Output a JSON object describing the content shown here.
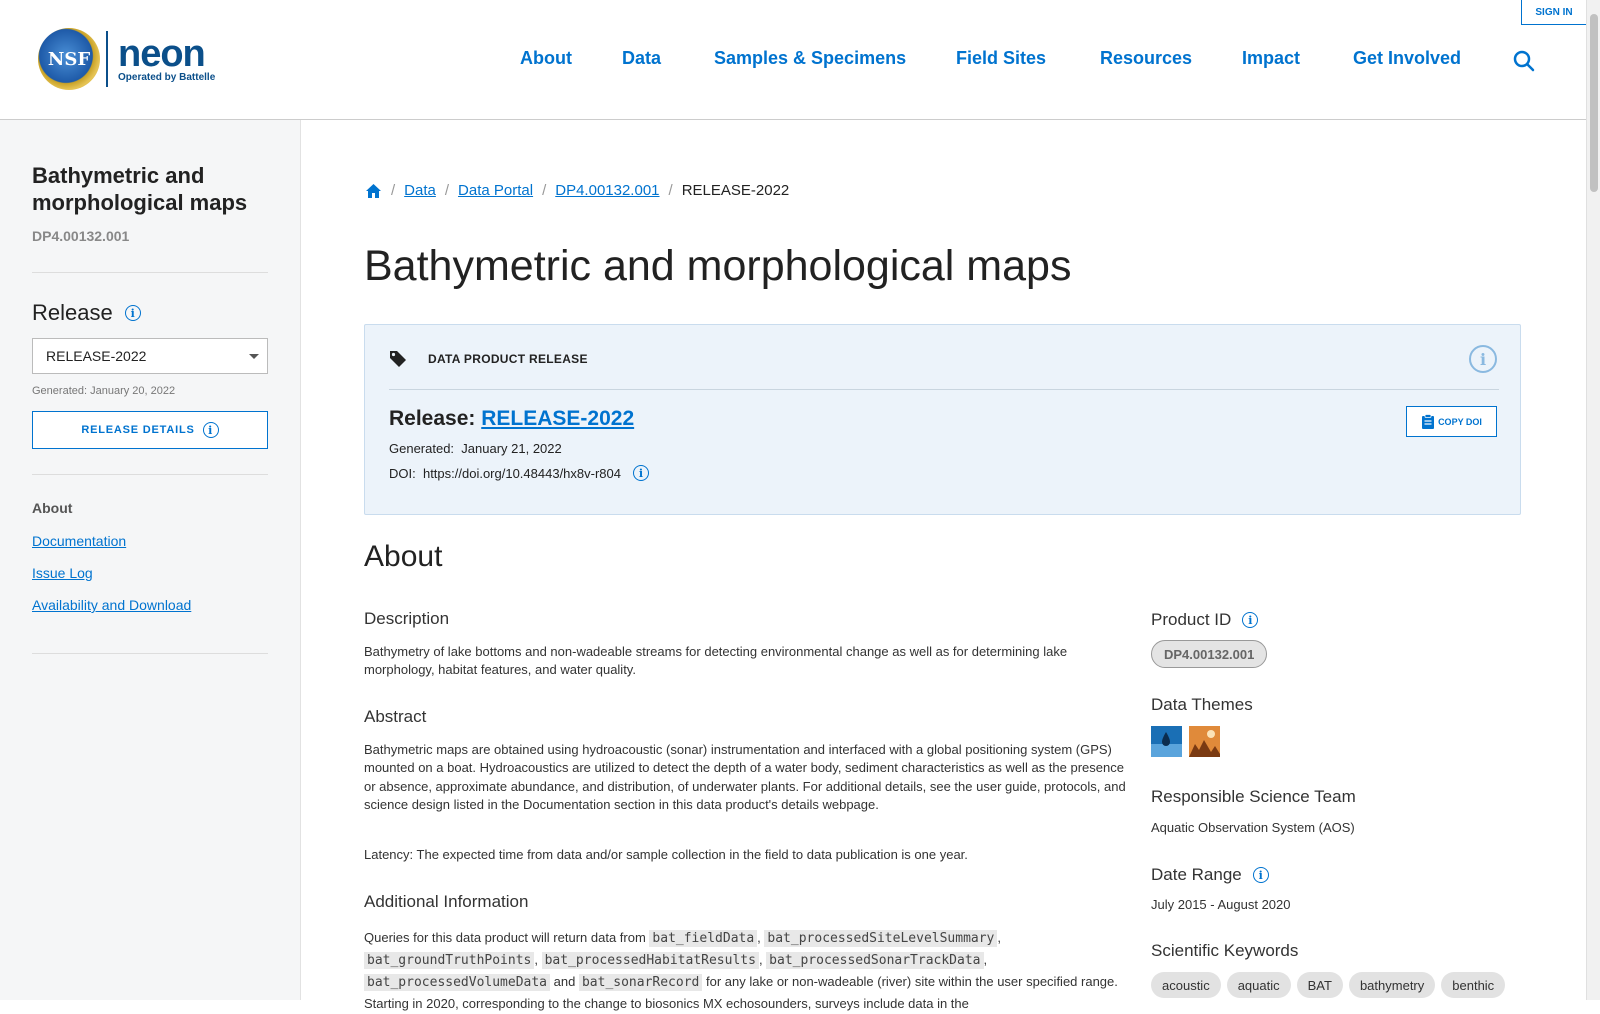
{
  "header": {
    "logo_seal_text": "NSF",
    "logo_name": "neon",
    "logo_operated": "Operated by Battelle",
    "nav": [
      "About",
      "Data",
      "Samples & Specimens",
      "Field Sites",
      "Resources",
      "Impact",
      "Get Involved"
    ],
    "sign_in": "SIGN IN"
  },
  "sidebar": {
    "title": "Bathymetric and morphological maps",
    "product_id": "DP4.00132.001",
    "release_heading": "Release",
    "release_selected": "RELEASE-2022",
    "generated": "Generated: January 20, 2022",
    "release_details_button": "RELEASE DETAILS",
    "about_heading": "About",
    "links": [
      "Documentation",
      "Issue Log",
      "Availability and Download"
    ]
  },
  "breadcrumb": {
    "items": [
      "Data",
      "Data Portal",
      "DP4.00132.001"
    ],
    "current": "RELEASE-2022"
  },
  "page_title": "Bathymetric and morphological maps",
  "release_box": {
    "title": "DATA PRODUCT RELEASE",
    "release_label": "Release:",
    "release_value": "RELEASE-2022",
    "generated_label": "Generated:",
    "generated_value": "January 21, 2022",
    "doi_label": "DOI:",
    "doi_value": "https://doi.org/10.48443/hx8v-r804",
    "copy_doi": "COPY DOI"
  },
  "about": {
    "heading": "About",
    "description_heading": "Description",
    "description": "Bathymetry of lake bottoms and non-wadeable streams for detecting environmental change as well as for determining lake morphology, habitat features, and water quality.",
    "abstract_heading": "Abstract",
    "abstract": "Bathymetric maps are obtained using hydroacoustic (sonar) instrumentation and interfaced with a global positioning system (GPS) mounted on a boat. Hydroacoustics are utilized to detect the depth of a water body, sediment characteristics as well as the presence or absence, approximate abundance, and distribution, of underwater plants. For additional details, see the user guide, protocols, and science design listed in the Documentation section in this data product's details webpage.",
    "latency": "Latency: The expected time from data and/or sample collection in the field to data publication is one year.",
    "additional_heading": "Additional Information",
    "additional_prefix": "Queries for this data product will return data from",
    "tables": [
      "bat_fieldData",
      "bat_processedSiteLevelSummary",
      "bat_groundTruthPoints",
      "bat_processedHabitatResults",
      "bat_processedSonarTrackData",
      "bat_processedVolumeData",
      "bat_sonarRecord"
    ],
    "and_word": "and",
    "additional_suffix": "for any lake or non-wadeable (river) site within the user specified range. Starting in 2020, corresponding to the change to biosonics MX echosounders, surveys include data in the"
  },
  "right_col": {
    "product_id_heading": "Product ID",
    "product_id": "DP4.00132.001",
    "themes_heading": "Data Themes",
    "themes": [
      "water-drop-icon",
      "landscape-icon"
    ],
    "team_heading": "Responsible Science Team",
    "team": "Aquatic Observation System (AOS)",
    "date_range_heading": "Date Range",
    "date_range": "July 2015 - August 2020",
    "keywords_heading": "Scientific Keywords",
    "keywords": [
      "acoustic",
      "aquatic",
      "BAT",
      "bathymetry",
      "benthic"
    ]
  },
  "colors": {
    "link": "#0073cf",
    "release_box_bg": "#ecf3fa",
    "sidebar_bg": "#f5f6f7"
  }
}
